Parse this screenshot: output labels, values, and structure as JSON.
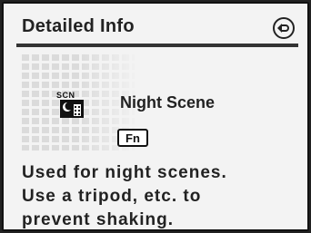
{
  "header": {
    "title": "Detailed Info",
    "back_icon": "playback-return-icon"
  },
  "mode": {
    "badge": "SCN",
    "icon": "night-scene-icon",
    "name": "Night Scene",
    "fn_key_label": "Fn"
  },
  "description": {
    "lines": [
      "Used for night scenes.",
      "Use a tripod, etc. to",
      "prevent shaking."
    ]
  }
}
